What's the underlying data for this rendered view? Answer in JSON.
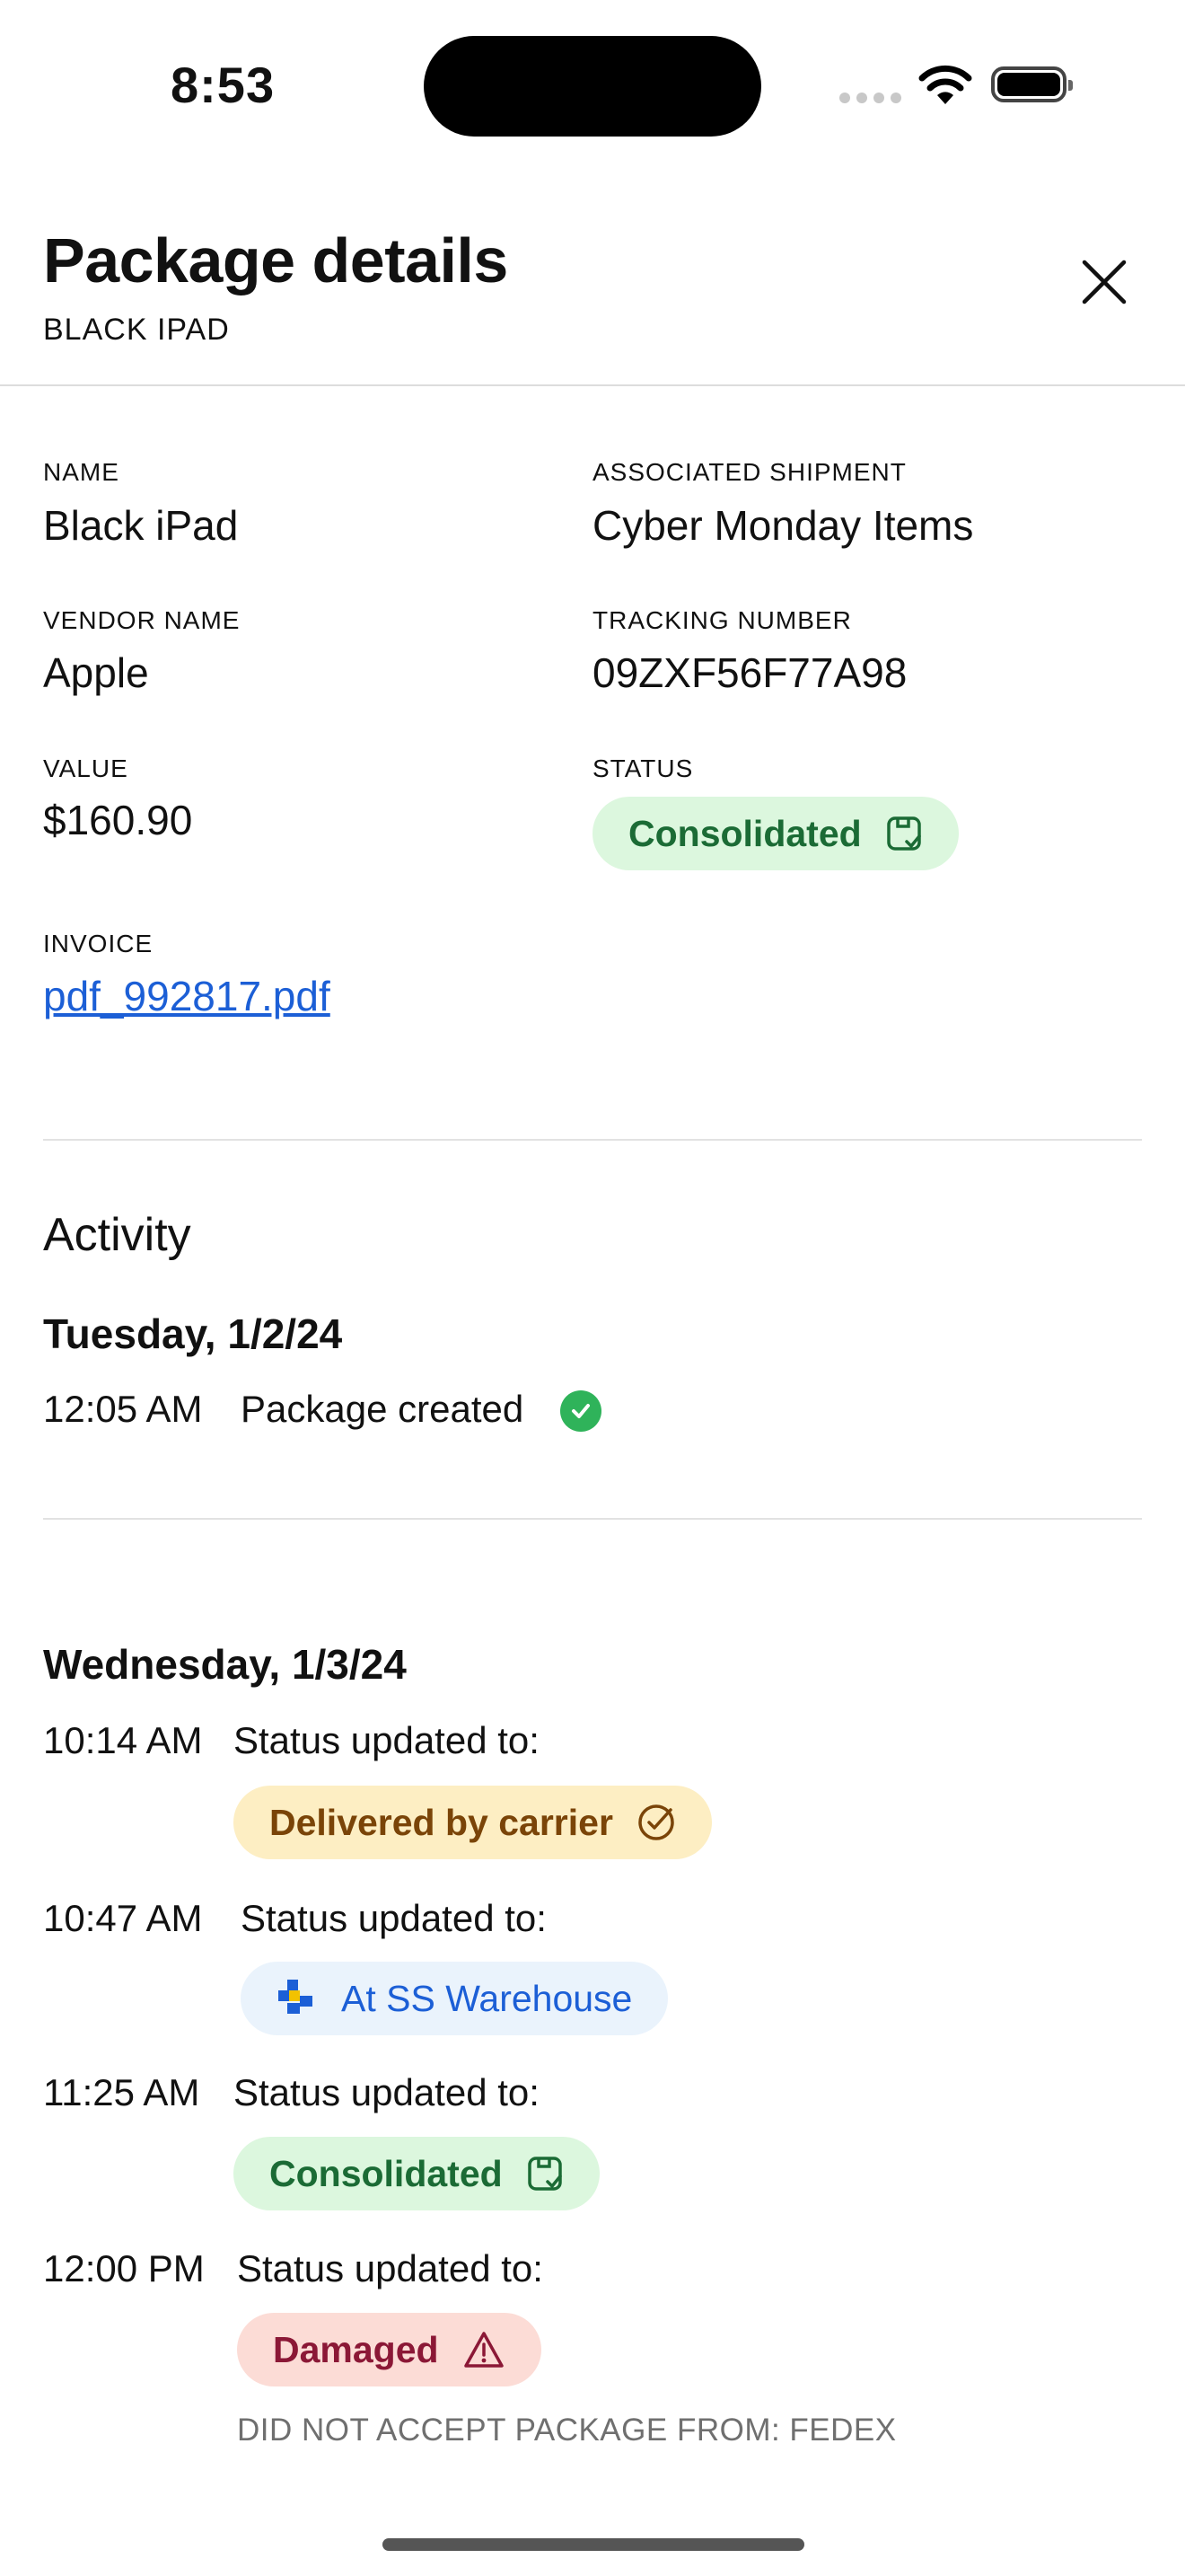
{
  "status_bar": {
    "time": "8:53"
  },
  "header": {
    "title": "Package details",
    "subtitle": "BLACK IPAD"
  },
  "details": {
    "name_label": "NAME",
    "name_value": "Black iPad",
    "shipment_label": "ASSOCIATED SHIPMENT",
    "shipment_value": "Cyber Monday Items",
    "vendor_label": "VENDOR NAME",
    "vendor_value": "Apple",
    "tracking_label": "TRACKING NUMBER",
    "tracking_value": "09ZXF56F77A98",
    "value_label": "VALUE",
    "value_value": "$160.90",
    "status_label": "STATUS",
    "status_value": "Consolidated",
    "invoice_label": "INVOICE",
    "invoice_value": "pdf_992817.pdf"
  },
  "activity": {
    "title": "Activity",
    "days": [
      {
        "date": "Tuesday, 1/2/24",
        "events": [
          {
            "time": "12:05 AM",
            "text": "Package created"
          }
        ]
      },
      {
        "date": "Wednesday, 1/3/24",
        "events": [
          {
            "time": "10:14 AM",
            "text": "Status updated to:",
            "status": "Delivered by carrier"
          },
          {
            "time": "10:47 AM",
            "text": "Status updated to:",
            "status": "At SS Warehouse"
          },
          {
            "time": "11:25 AM",
            "text": "Status updated to:",
            "status": "Consolidated"
          },
          {
            "time": "12:00 PM",
            "text": "Status updated to:",
            "status": "Damaged",
            "note": "DID NOT ACCEPT PACKAGE FROM: FEDEX"
          }
        ]
      }
    ]
  },
  "colors": {
    "consolidated_bg": "#dcf7de",
    "delivered_bg": "#fdeec3",
    "warehouse_bg": "#eaf3fc",
    "damaged_bg": "#fcdcd6",
    "link": "#1c5fd6",
    "success": "#2fb35a"
  },
  "icons": [
    "close-icon",
    "box-check-icon",
    "circle-check-icon",
    "warehouse-logo-icon",
    "warning-triangle-icon",
    "check-circle-icon",
    "wifi-icon",
    "battery-icon"
  ]
}
